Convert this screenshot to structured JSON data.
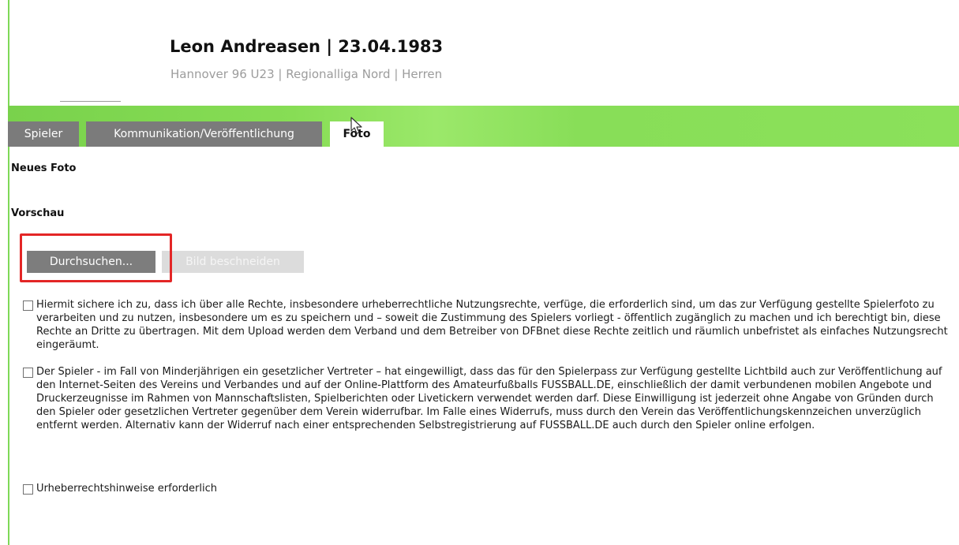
{
  "header": {
    "player_name": "Leon Andreasen | 23.04.1983",
    "player_subtitle": "Hannover 96 U23 | Regionalliga Nord | Herren"
  },
  "tabs": [
    {
      "label": "Spieler",
      "active": false
    },
    {
      "label": "Kommunikation/Veröffentlichung",
      "active": false
    },
    {
      "label": "Foto",
      "active": true
    }
  ],
  "photo": {
    "new_photo_label": "Neues Foto",
    "preview_label": "Vorschau",
    "browse_button": "Durchsuchen...",
    "crop_button": "Bild beschneiden"
  },
  "consents": [
    {
      "checked": false,
      "text": "Hiermit sichere ich zu, dass ich über alle Rechte, insbesondere urheberrechtliche Nutzungsrechte, verfüge, die erforderlich sind, um das zur Verfügung gestellte Spielerfoto zu verarbeiten und zu nutzen, insbesondere um es zu speichern und – soweit die Zustimmung des Spielers vorliegt - öffentlich zugänglich zu machen und ich berechtigt bin, diese Rechte an Dritte zu übertragen. Mit dem Upload werden dem Verband und dem Betreiber von DFBnet diese Rechte zeitlich und räumlich unbefristet als einfaches Nutzungsrecht eingeräumt."
    },
    {
      "checked": false,
      "text": "Der Spieler - im Fall von Minderjährigen ein gesetzlicher Vertreter – hat eingewilligt, dass das für den Spielerpass zur Verfügung gestellte Lichtbild auch zur Veröffentlichung auf den Internet-Seiten des Vereins und Verbandes und auf der Online-Plattform des Amateurfußballs FUSSBALL.DE, einschließlich der damit verbundenen mobilen Angebote und Druckerzeugnisse im Rahmen von Mannschaftslisten, Spielberichten oder Livetickern verwendet werden darf. Diese Einwilligung ist jederzeit ohne Angabe von Gründen durch den Spieler oder gesetzlichen Vertreter gegenüber dem Verein widerrufbar. Im Falle eines Widerrufs, muss durch den Verein das Veröffentlichungskennzeichen unverzüglich entfernt werden. Alternativ kann der Widerruf nach einer entsprechenden Selbstregistrierung auf FUSSBALL.DE auch durch den Spieler online erfolgen."
    },
    {
      "checked": false,
      "text": "Urheberrechtshinweise erforderlich"
    }
  ],
  "colors": {
    "accent_green": "#86dc55",
    "tab_inactive": "#7b7b7b",
    "highlight_red": "#e32626"
  }
}
